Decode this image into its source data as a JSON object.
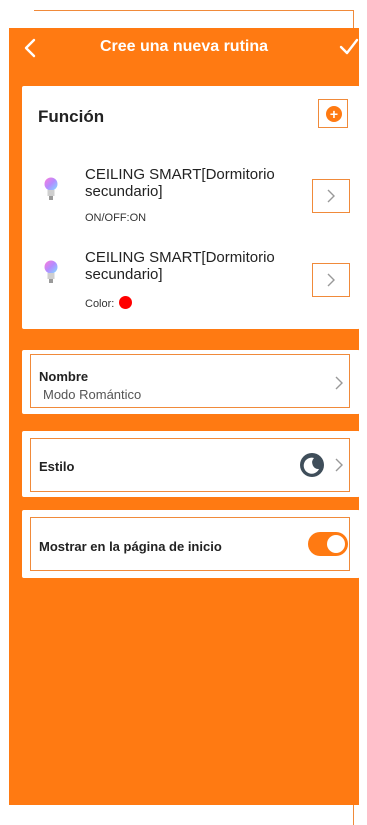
{
  "header": {
    "title": "Cree una nueva rutina",
    "back_icon": "chevron-left-icon",
    "confirm_icon": "check-icon"
  },
  "function": {
    "title": "Función",
    "add_icon": "plus-circle-icon",
    "items": [
      {
        "name": "CEILING SMART[Dormitorio secundario]",
        "status": "ON/OFF:ON",
        "icon": "bulb-icon"
      },
      {
        "name": "CEILING SMART[Dormitorio secundario]",
        "status": "Color:",
        "color": "#ff0000",
        "icon": "bulb-icon"
      }
    ]
  },
  "name_row": {
    "label": "Nombre",
    "value": "Modo Romántico"
  },
  "style_row": {
    "label": "Estilo",
    "icon": "moon-icon"
  },
  "home_row": {
    "label": "Mostrar en la página de inicio",
    "toggle_on": true
  },
  "colors": {
    "accent": "#ff7a12",
    "outline": "#f08a3a",
    "moon": "#3f4e5a"
  }
}
